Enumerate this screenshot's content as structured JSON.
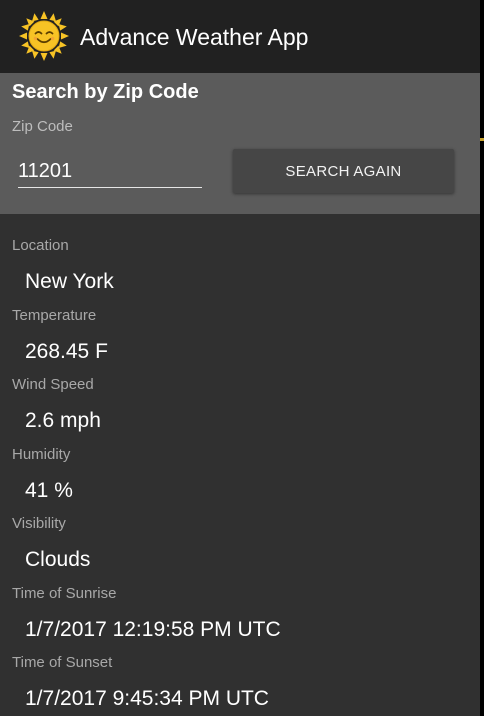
{
  "app_bar": {
    "title": "Advance Weather App",
    "logo_icon": "sun-icon",
    "background": "#212121"
  },
  "search": {
    "heading": "Search by Zip Code",
    "zip_label": "Zip Code",
    "zip_value": "11201",
    "button_label": "SEARCH AGAIN",
    "panel_color": "#5b5b5b"
  },
  "weather": {
    "items": [
      {
        "label": "Location",
        "value": "New York"
      },
      {
        "label": "Temperature",
        "value": "268.45 F"
      },
      {
        "label": "Wind Speed",
        "value": "2.6 mph"
      },
      {
        "label": "Humidity",
        "value": "41 %"
      },
      {
        "label": "Visibility",
        "value": "Clouds"
      },
      {
        "label": "Time of Sunrise",
        "value": "1/7/2017 12:19:58 PM UTC"
      },
      {
        "label": "Time of Sunset",
        "value": "1/7/2017 9:45:34 PM UTC"
      }
    ]
  },
  "colors": {
    "background": "#303030",
    "sun": "#f7c325",
    "label_text": "#a8a8a8",
    "value_text": "#ffffff"
  }
}
